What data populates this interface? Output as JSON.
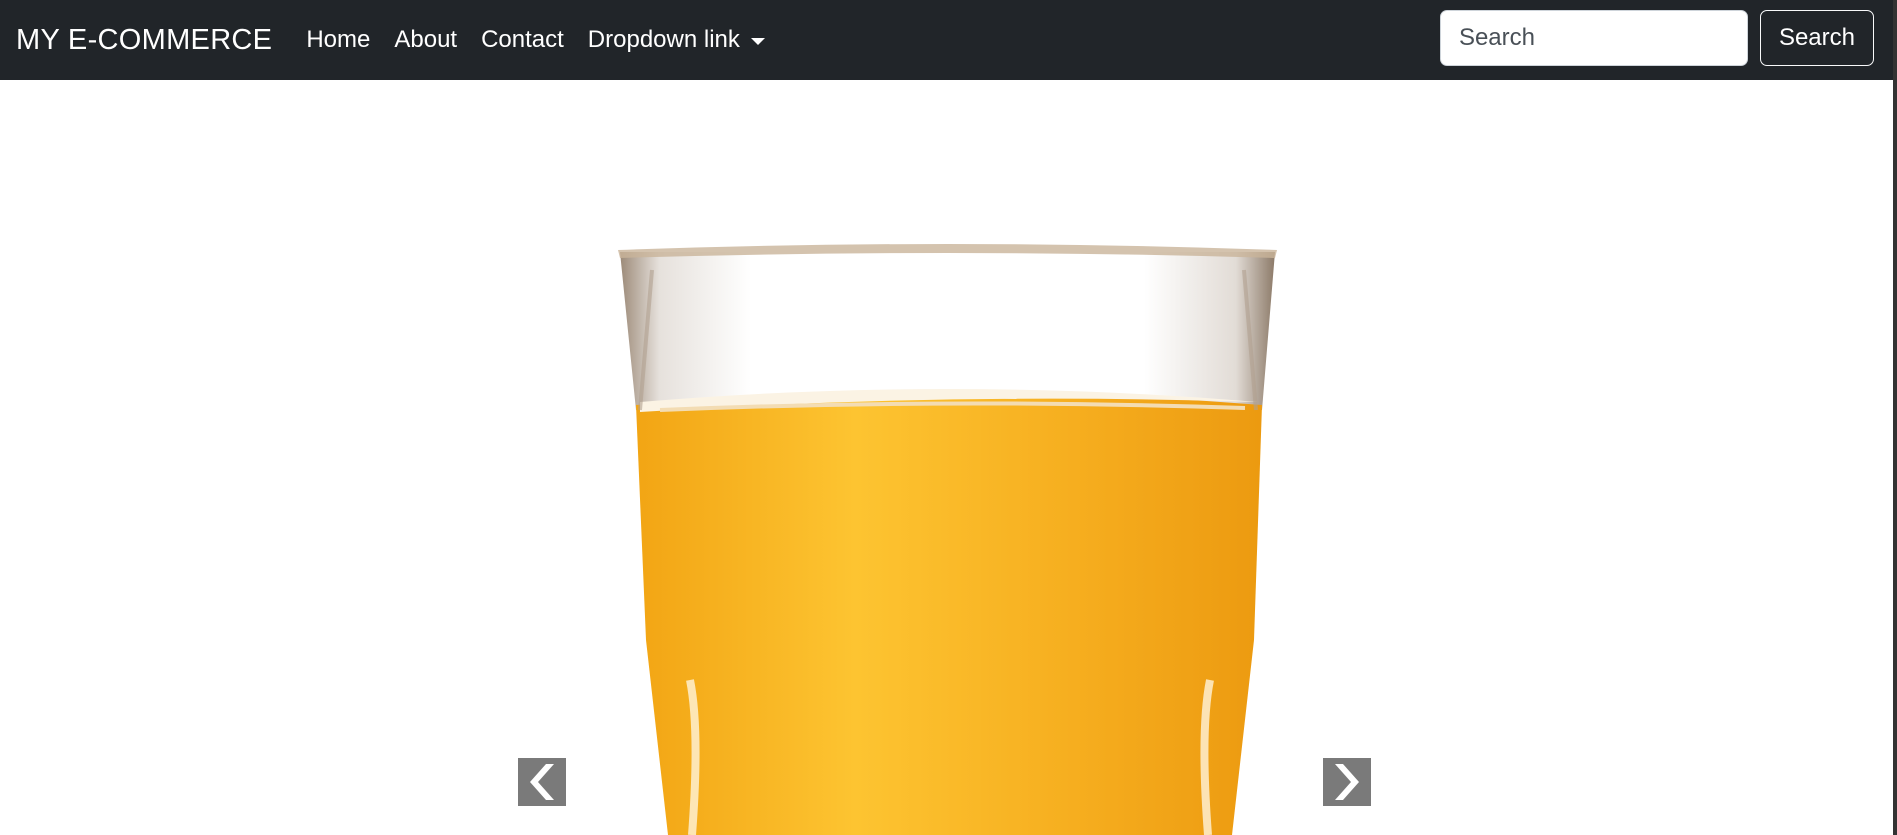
{
  "navbar": {
    "brand": "MY E-COMMERCE",
    "links": [
      {
        "label": "Home"
      },
      {
        "label": "About"
      },
      {
        "label": "Contact"
      }
    ],
    "dropdown": {
      "label": "Dropdown link"
    }
  },
  "search": {
    "placeholder": "Search",
    "button_label": "Search"
  },
  "carousel": {
    "slide_image": "orange-juice-glass",
    "prev_icon": "chevron-left-icon",
    "next_icon": "chevron-right-icon"
  },
  "colors": {
    "navbar_bg": "#212529",
    "juice": "#f5a81c",
    "control_bg": "#7a7a7a"
  }
}
